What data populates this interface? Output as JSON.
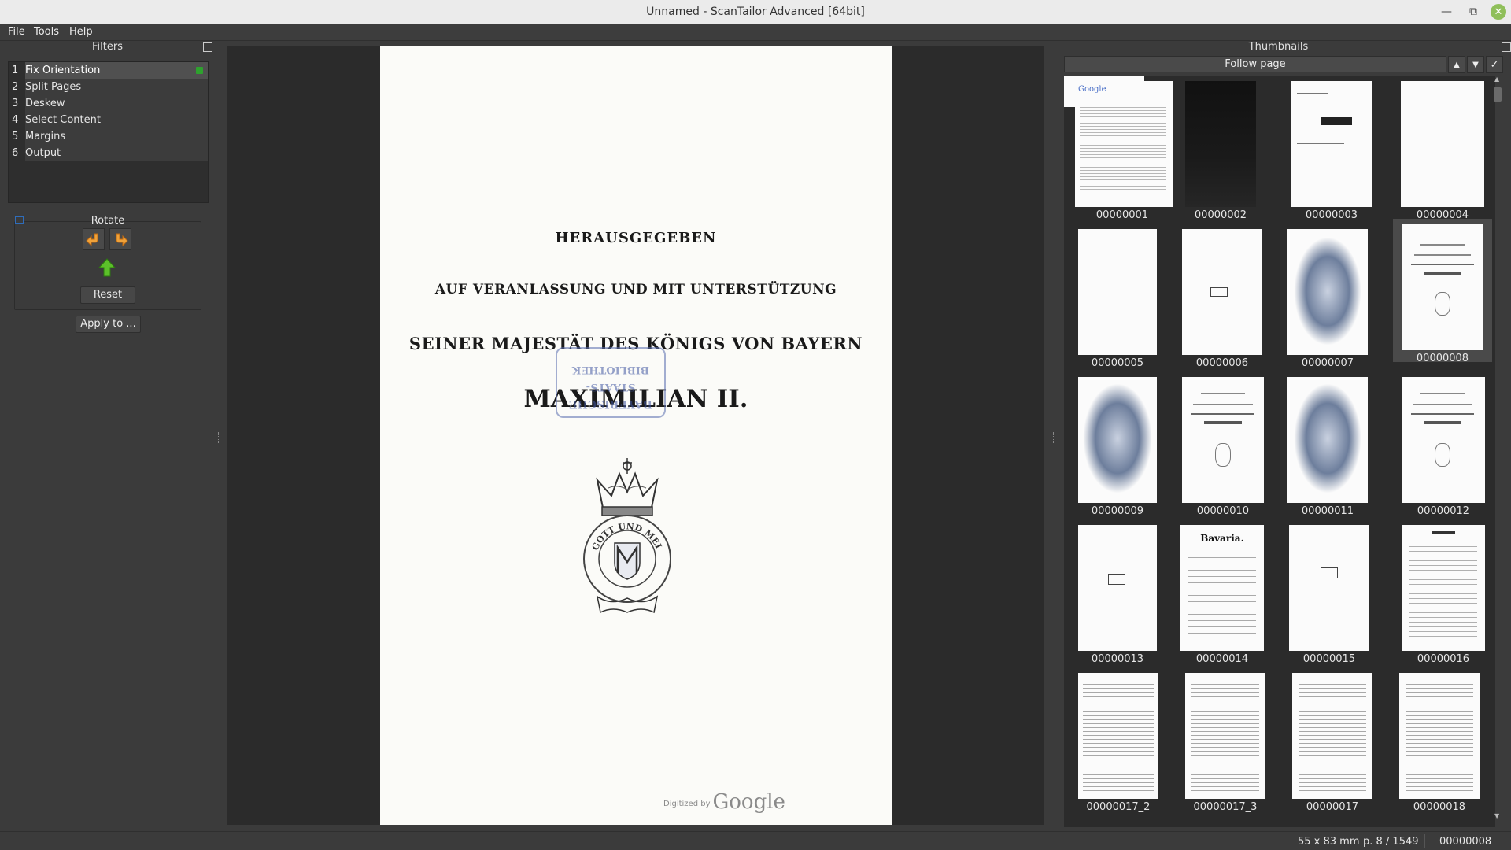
{
  "window": {
    "title": "Unnamed - ScanTailor Advanced [64bit]"
  },
  "menu": {
    "file": "File",
    "tools": "Tools",
    "help": "Help"
  },
  "filters": {
    "title": "Filters",
    "items": [
      {
        "num": "1",
        "label": "Fix Orientation"
      },
      {
        "num": "2",
        "label": "Split Pages"
      },
      {
        "num": "3",
        "label": "Deskew"
      },
      {
        "num": "4",
        "label": "Select Content"
      },
      {
        "num": "5",
        "label": "Margins"
      },
      {
        "num": "6",
        "label": "Output"
      }
    ],
    "active_item": "Fix Orientation",
    "rotate": {
      "title": "Rotate",
      "reset": "Reset"
    },
    "apply": "Apply to ..."
  },
  "page_image": {
    "line1": "HERAUSGEGEBEN",
    "line2": "AUF VERANLASSUNG UND MIT UNTERSTÜTZUNG",
    "line3": "SEINER MAJESTÄT DES KÖNIGS VON BAYERN",
    "line4": "MAXIMILIAN II.",
    "stamp1": "BAYERISCHE",
    "stamp2": "STAATS-",
    "stamp3": "BIBLIOTHEK",
    "crest_motto": "GOTT UND MEIN VOLK.",
    "digitized_by": "Digitized by",
    "google": "Google"
  },
  "thumbnails": {
    "title": "Thumbnails",
    "follow": "Follow page",
    "selected": "00000008",
    "items": [
      {
        "label": "00000001"
      },
      {
        "label": "00000002"
      },
      {
        "label": "00000003"
      },
      {
        "label": "00000004"
      },
      {
        "label": "00000005"
      },
      {
        "label": "00000006"
      },
      {
        "label": "00000007"
      },
      {
        "label": "00000008"
      },
      {
        "label": "00000009"
      },
      {
        "label": "00000010"
      },
      {
        "label": "00000011"
      },
      {
        "label": "00000012"
      },
      {
        "label": "00000013"
      },
      {
        "label": "00000014"
      },
      {
        "label": "00000015"
      },
      {
        "label": "00000016"
      },
      {
        "label": "00000017_2"
      },
      {
        "label": "00000017_3"
      },
      {
        "label": "00000017"
      },
      {
        "label": "00000018"
      }
    ],
    "thumb1_logo": "Google",
    "thumb14_title": "Bavaria."
  },
  "status": {
    "size": "55 x 83 mm",
    "page": "p. 8 / 1549",
    "name": "00000008"
  },
  "colors": {
    "accent_green": "#2ea22e",
    "panel_bg": "#3b3b3b",
    "viewer_bg": "#2b2b2b",
    "rotate_arrow": "#f0a23a",
    "up_arrow": "#5cc02a"
  },
  "icons": {
    "rotate_left": "rotate-left-icon",
    "rotate_right": "rotate-right-icon",
    "up": "up-arrow-icon",
    "prev": "triangle-up-icon",
    "next": "triangle-down-icon",
    "check": "check-icon"
  }
}
